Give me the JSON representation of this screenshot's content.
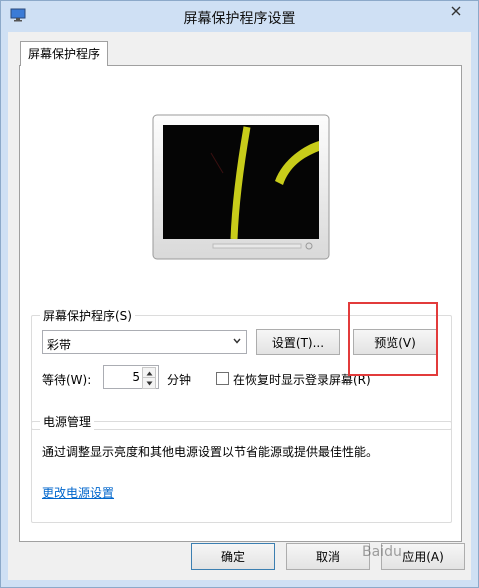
{
  "window": {
    "title": "屏幕保护程序设置"
  },
  "tab": {
    "label": "屏幕保护程序"
  },
  "screensaver": {
    "group_label": "屏幕保护程序(S)",
    "selected": "彩带",
    "settings_button": "设置(T)...",
    "preview_button": "预览(V)",
    "wait_label": "等待(W):",
    "wait_value": "5",
    "wait_unit": "分钟",
    "resume_checkbox_label": "在恢复时显示登录屏幕(R)",
    "resume_checked": false
  },
  "power": {
    "group_label": "电源管理",
    "description": "通过调整显示亮度和其他电源设置以节省能源或提供最佳性能。",
    "link": "更改电源设置"
  },
  "footer": {
    "ok": "确定",
    "cancel": "取消",
    "apply": "应用(A)"
  },
  "watermark": "Baidu",
  "colors": {
    "highlight": "#e23b3b",
    "link": "#0066cc",
    "ribbon": "#c8cc1a"
  }
}
